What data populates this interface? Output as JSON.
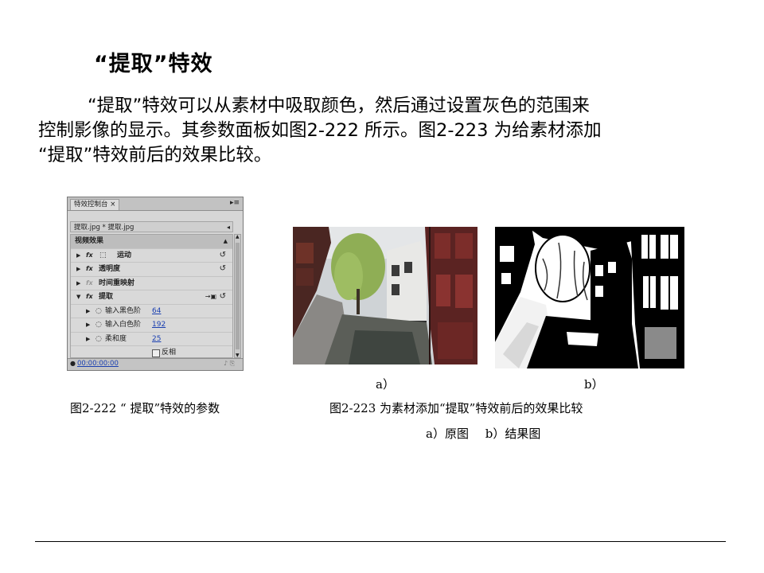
{
  "title": "“提取”特效",
  "paragraph": {
    "line1": "“提取”特效可以从素材中吸取颜色，然后通过设置灰色的范围来",
    "line2": "控制影像的显示。其参数面板如图2-222 所示。图2-223 为给素材添加",
    "line3": "“提取”特效前后的效果比较。"
  },
  "panel": {
    "tab_label": "特效控制台 ×",
    "menu_icon": "panel-menu-icon",
    "clip_label": "提取.jpg * 提取.jpg",
    "section_header": "视频效果",
    "effects": [
      {
        "label": "运动",
        "icon": "motion-icon"
      },
      {
        "label": "透明度"
      },
      {
        "label": "时间重映射"
      },
      {
        "label": "提取"
      }
    ],
    "params": [
      {
        "label": "输入黑色阶",
        "value": "64"
      },
      {
        "label": "输入白色阶",
        "value": "192"
      },
      {
        "label": "柔和度",
        "value": "25"
      }
    ],
    "invert_label": "反相",
    "invert_checked": false,
    "timecode": "00:00:00:00"
  },
  "photos": {
    "a_label": "a）",
    "b_label": "b）"
  },
  "captions": {
    "fig222": "图2-222 “ 提取”特效的参数",
    "fig223": "图2-223 为素材添加“提取”特效前后的效果比较",
    "sub_a": "a）原图",
    "sub_b": "b）结果图"
  },
  "colors": {
    "link_blue": "#1a3fb0",
    "panel_bg": "#d6d6d6"
  }
}
